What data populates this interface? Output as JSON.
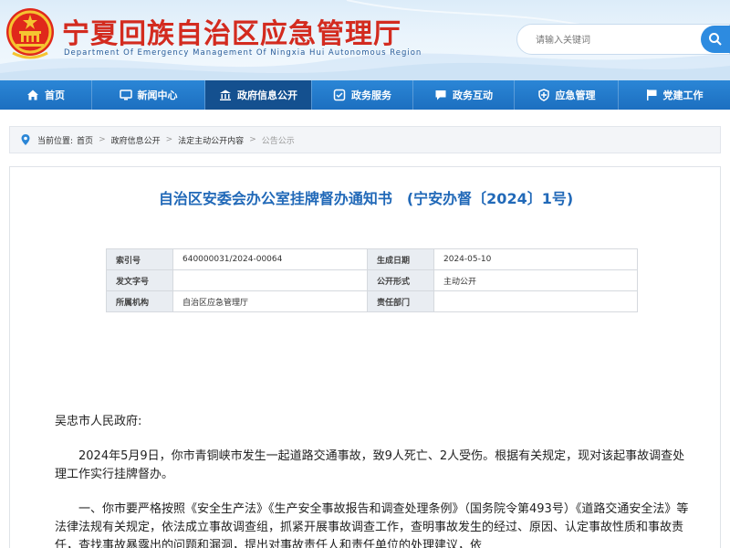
{
  "header": {
    "site_title": "宁夏回族自治区应急管理厅",
    "site_subtitle": "Department Of Emergency Management Of Ningxia Hui Autonomous Region",
    "search_placeholder": "请输入关键词",
    "emblem_icon": "national-emblem-icon",
    "search_icon": "search-icon"
  },
  "nav": {
    "items": [
      {
        "label": "首页",
        "icon": "home-icon"
      },
      {
        "label": "新闻中心",
        "icon": "monitor-icon"
      },
      {
        "label": "政府信息公开",
        "icon": "government-building-icon"
      },
      {
        "label": "政务服务",
        "icon": "service-icon"
      },
      {
        "label": "政务互动",
        "icon": "chat-icon"
      },
      {
        "label": "应急管理",
        "icon": "emergency-icon"
      },
      {
        "label": "党建工作",
        "icon": "party-flag-icon"
      }
    ],
    "active_index": 2,
    "colors": {
      "bar": "#1c6fc0",
      "active": "#14508f"
    }
  },
  "breadcrumb": {
    "prefix": "当前位置:",
    "items": [
      "首页",
      "政府信息公开",
      "法定主动公开内容"
    ],
    "current": "公告公示"
  },
  "document": {
    "title": "自治区安委会办公室挂牌督办通知书",
    "number": "(宁安办督〔2024〕1号)",
    "meta": {
      "index_label": "索引号",
      "index_value": "640000031/2024-00064",
      "date_label": "生成日期",
      "date_value": "2024-05-10",
      "doc_no_label": "发文字号",
      "doc_no_value": "",
      "form_label": "公开形式",
      "form_value": "主动公开",
      "org_label": "所属机构",
      "org_value": "自治区应急管理厅",
      "dept_label": "责任部门",
      "dept_value": ""
    },
    "greeting": "吴忠市人民政府:",
    "paragraph1": "2024年5月9日，你市青铜峡市发生一起道路交通事故，致9人死亡、2人受伤。根据有关规定，现对该起事故调查处理工作实行挂牌督办。",
    "paragraph2": "一、你市要严格按照《安全生产法》《生产安全事故报告和调查处理条例》（国务院令第493号）《道路交通安全法》等法律法规有关规定，依法成立事故调查组，抓紧开展事故调查工作，查明事故发生的经过、原因、认定事故性质和事故责任，查找事故暴露出的问题和漏洞，提出对事故责任人和责任单位的处理建议，依"
  },
  "colors": {
    "title_red": "#d32b1f",
    "doc_title_blue": "#2169b8",
    "nav_blue": "#1c6fc0"
  }
}
